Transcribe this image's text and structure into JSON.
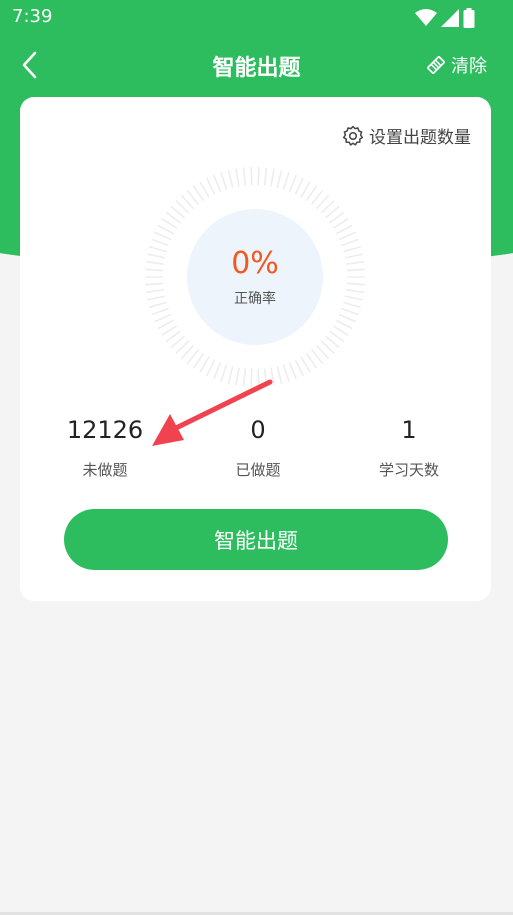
{
  "status_bar": {
    "time": "7:39",
    "icons": [
      "wifi-icon",
      "signal-icon",
      "battery-icon"
    ]
  },
  "header": {
    "title": "智能出题",
    "back_icon": "chevron-left-icon",
    "clear_label": "清除",
    "clear_icon": "eraser-icon"
  },
  "card": {
    "settings_label": "设置出题数量",
    "settings_icon": "gear-icon",
    "accuracy": {
      "value": "0%",
      "label": "正确率"
    },
    "stats": [
      {
        "value": "12126",
        "label": "未做题"
      },
      {
        "value": "0",
        "label": "已做题"
      },
      {
        "value": "1",
        "label": "学习天数"
      }
    ],
    "action_label": "智能出题"
  },
  "colors": {
    "brand_green": "#2dbd5f",
    "accuracy_orange": "#f0591f",
    "arrow_red": "#f0424f",
    "gauge_fill": "#eef4fc"
  }
}
